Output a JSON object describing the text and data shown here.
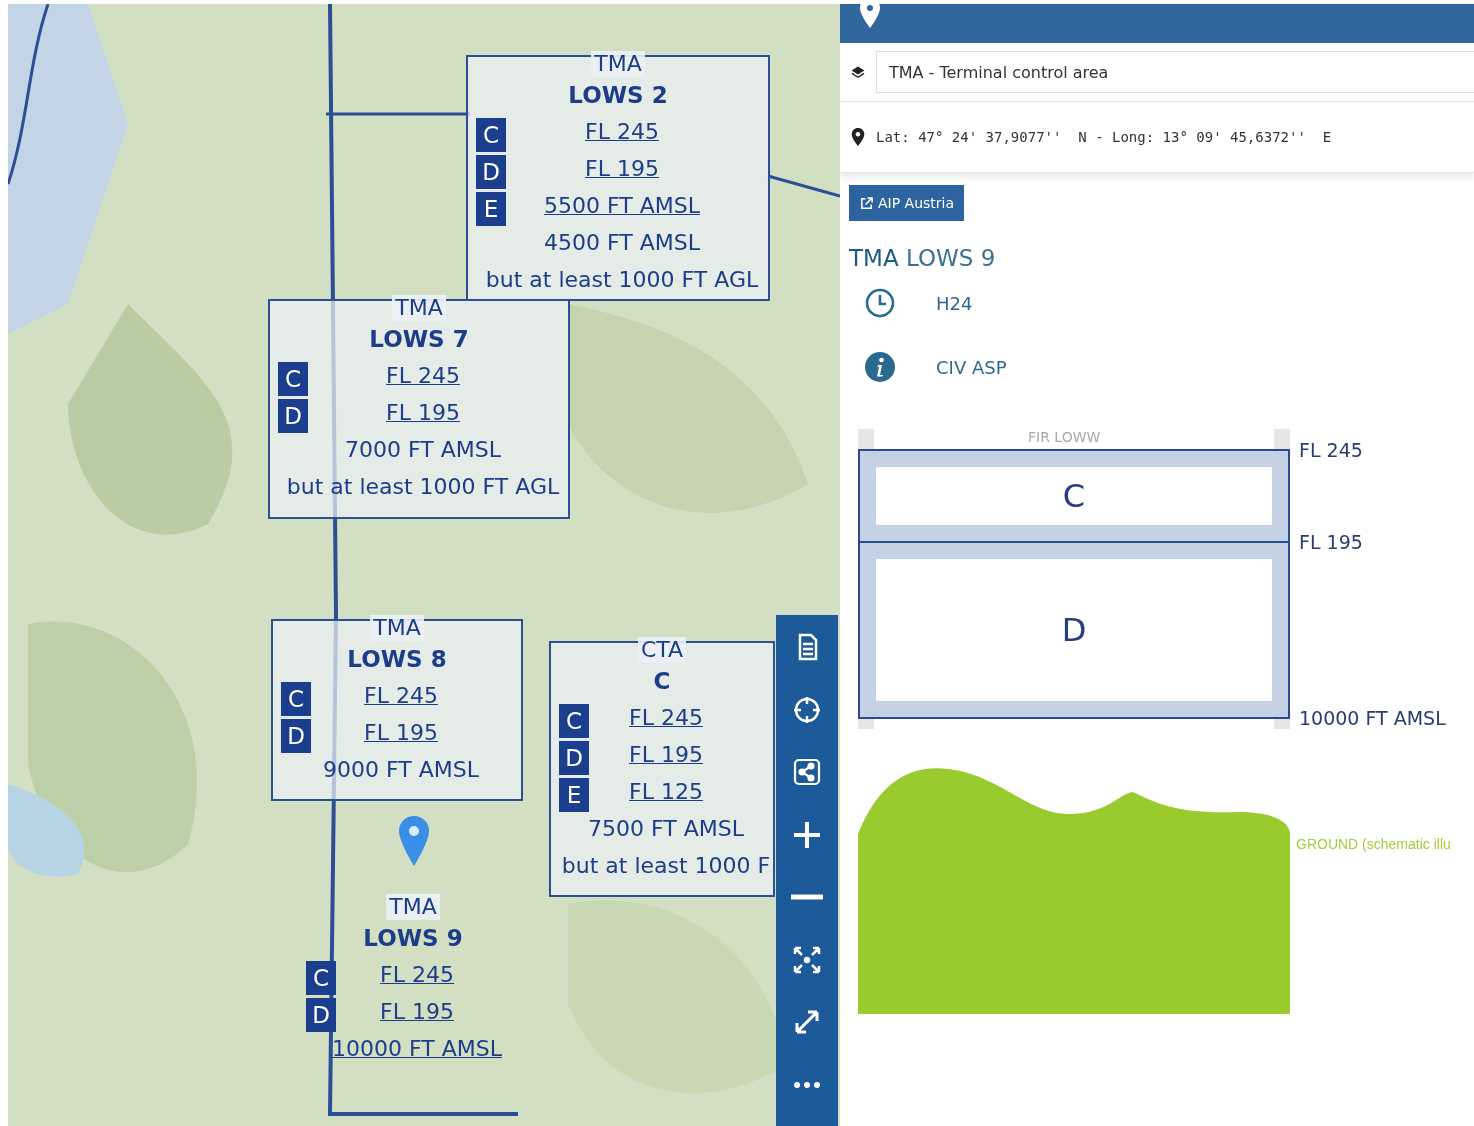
{
  "map": {
    "airspace_labels": [
      {
        "kind": "TMA",
        "name": "LOWS 2",
        "framed": true,
        "classes": [
          "C",
          "D",
          "E"
        ],
        "levels": [
          {
            "text": "FL 245",
            "underlined": true
          },
          {
            "text": "FL 195",
            "underlined": true
          },
          {
            "text": "5500 FT AMSL",
            "underlined": true
          },
          {
            "text": "4500 FT AMSL",
            "underlined": false
          },
          {
            "text": "but at least 1000 FT AGL",
            "underlined": false
          }
        ]
      },
      {
        "kind": "TMA",
        "name": "LOWS 7",
        "framed": true,
        "classes": [
          "C",
          "D"
        ],
        "levels": [
          {
            "text": "FL 245",
            "underlined": true
          },
          {
            "text": "FL 195",
            "underlined": true
          },
          {
            "text": "7000 FT AMSL",
            "underlined": false
          },
          {
            "text": "but at least 1000 FT AGL",
            "underlined": false
          }
        ]
      },
      {
        "kind": "TMA",
        "name": "LOWS 8",
        "framed": true,
        "classes": [
          "C",
          "D"
        ],
        "levels": [
          {
            "text": "FL 245",
            "underlined": true
          },
          {
            "text": "FL 195",
            "underlined": true
          },
          {
            "text": "9000 FT AMSL",
            "underlined": false
          }
        ]
      },
      {
        "kind": "CTA",
        "name": "C",
        "framed": true,
        "classes": [
          "C",
          "D",
          "E"
        ],
        "levels": [
          {
            "text": "FL 245",
            "underlined": true
          },
          {
            "text": "FL 195",
            "underlined": true
          },
          {
            "text": "FL 125",
            "underlined": true
          },
          {
            "text": "7500 FT AMSL",
            "underlined": false
          },
          {
            "text": "but at least 1000 F",
            "underlined": false
          }
        ]
      },
      {
        "kind": "TMA",
        "name": "LOWS 9",
        "framed": false,
        "classes": [
          "C",
          "D"
        ],
        "levels": [
          {
            "text": "FL 245",
            "underlined": true
          },
          {
            "text": "FL 195",
            "underlined": true
          },
          {
            "text": "10000 FT AMSL",
            "underlined": true
          }
        ]
      }
    ],
    "toolbar": [
      {
        "kind": "document"
      },
      {
        "kind": "crosshair"
      },
      {
        "kind": "share"
      },
      {
        "kind": "zoom-in"
      },
      {
        "kind": "zoom-out"
      },
      {
        "kind": "fit"
      },
      {
        "kind": "fullscreen"
      },
      {
        "kind": "more"
      }
    ]
  },
  "panel": {
    "layer": "TMA - Terminal control area",
    "coordinates": "Lat: 47° 24' 37,9077''  N - Long: 13° 09' 45,6372''  E",
    "link_button": "AIP Austria",
    "title_kind": "TMA",
    "title_name": "LOWS 9",
    "info": [
      {
        "kind": "hours",
        "text": "H24"
      },
      {
        "kind": "info",
        "text": "CIV ASP"
      }
    ],
    "profile": {
      "region": "FIR LOWW",
      "levels": [
        "FL 245",
        "FL 195",
        "10000 FT AMSL"
      ],
      "layers": [
        "C",
        "D"
      ],
      "ground_label": "GROUND (schematic illu"
    }
  }
}
